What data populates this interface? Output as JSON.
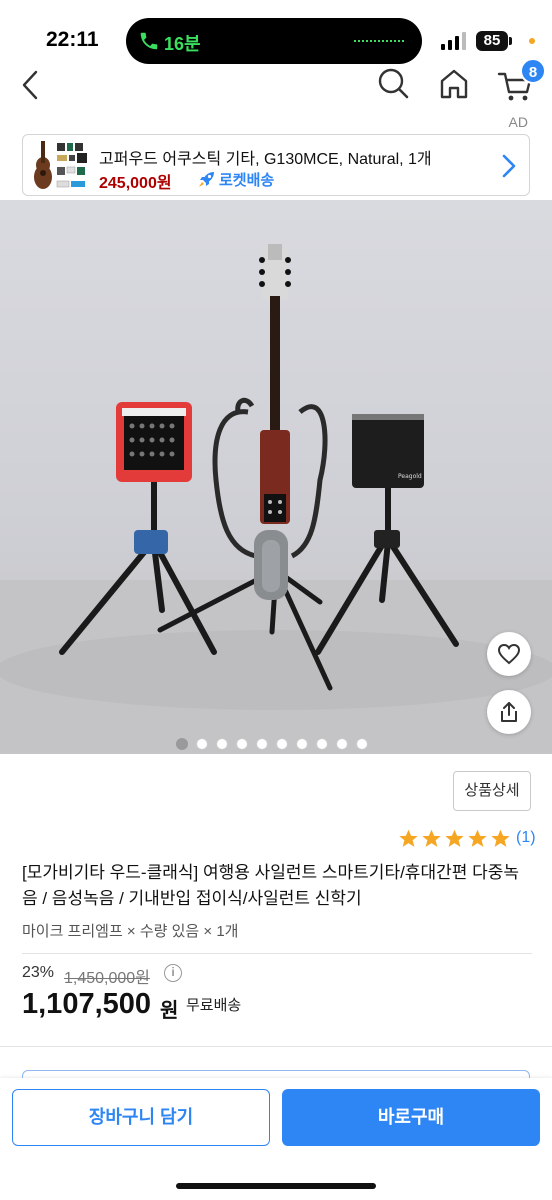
{
  "status_bar": {
    "time": "22:11",
    "call_label": "16분",
    "battery": "85"
  },
  "nav": {
    "cart_count": "8"
  },
  "ad": {
    "label": "AD",
    "product_name": "고퍼우드 어쿠스틱 기타, G130MCE, Natural, 1개",
    "price": "245,000원",
    "delivery": "로켓배송"
  },
  "gallery": {
    "total_images": 10,
    "current_index": 1
  },
  "product": {
    "detail_button": "상품상세",
    "rating": 5,
    "review_count": "(1)",
    "title": "[모가비기타 우드-클래식] 여행용 사일런트 스마트기타/휴대간편 다중녹음 / 음성녹음 / 기내반입 접이식/사일런트 신학기",
    "option": "마이크 프리엠프 × 수량  있음 × 1개",
    "discount": "23%",
    "original_price": "1,450,000원",
    "price": "1,107,500",
    "price_unit": "원",
    "shipping": "무료배송"
  },
  "actions": {
    "cart_button": "장바구니 담기",
    "buy_button": "바로구매"
  },
  "colors": {
    "accent": "#2e86f5",
    "ad_price": "#ae0000",
    "star": "#f5a623"
  }
}
